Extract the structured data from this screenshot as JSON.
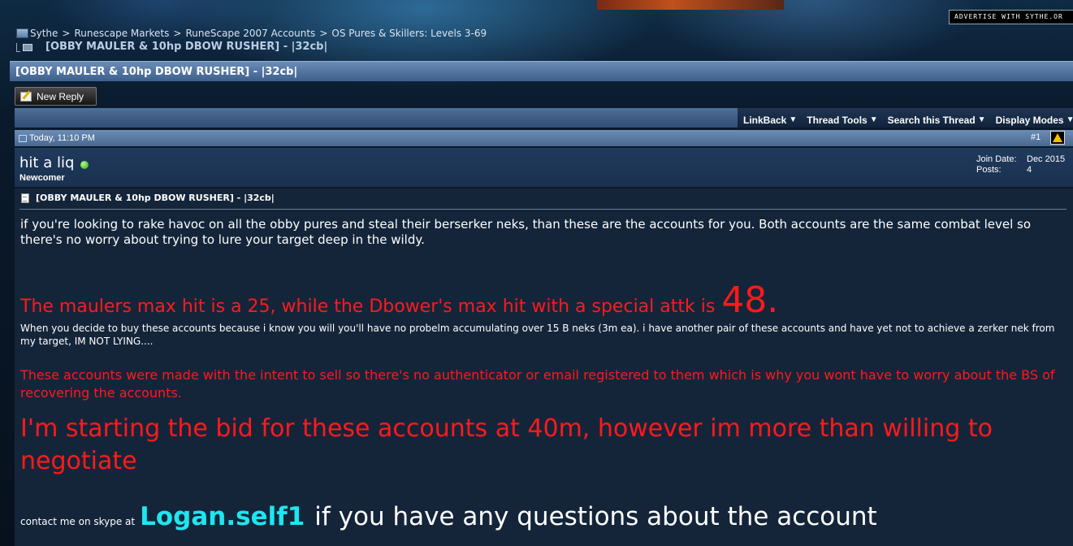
{
  "advertise": "ADVERTISE WITH SYTHE.OR",
  "breadcrumb": {
    "items": [
      "Sythe",
      "Runescape Markets",
      "RuneScape 2007 Accounts",
      "OS Pures & Skillers: Levels 3-69"
    ],
    "separator": ">",
    "current": "[OBBY MAULER & 10hp DBOW RUSHER] - |32cb|"
  },
  "thread": {
    "title": "[OBBY MAULER & 10hp DBOW RUSHER] - |32cb|",
    "new_reply_label": "New Reply"
  },
  "toolbar": {
    "items": [
      "LinkBack",
      "Thread Tools",
      "Search this Thread",
      "Display Modes"
    ]
  },
  "post": {
    "date": "Today, 11:10 PM",
    "number": "#1",
    "username": "hit a liq",
    "usertitle": "Newcomer",
    "join_date_label": "Join Date:",
    "join_date": "Dec 2015",
    "posts_label": "Posts:",
    "posts": "4",
    "title": "[OBBY MAULER & 10hp DBOW RUSHER] - |32cb|",
    "paragraph1": "if you're looking to rake havoc on all the obby pures and steal their berserker neks, than these are the accounts for you. Both accounts are the same combat level so there's no worry about trying to lure your target deep in the wildy.",
    "paragraph2": "The maulers max hit is a 25, while the Dbower's max hit with a special attk is",
    "paragraph2_big": "48.",
    "paragraph3": "When you decide to buy these accounts because i know you will you'll have no probelm accumulating over 15 B neks (3m ea). i have another pair of these accounts and have yet not to achieve a zerker nek from my target, IM NOT LYING....",
    "paragraph4": "These accounts were made with the intent to sell so there's no authenticator or email registered to them which is why you wont have to worry about the BS of recovering the accounts.",
    "paragraph5": "I'm starting the bid for these accounts at 40m, however im more than willing to negotiate",
    "contact_prefix": "contact me on skype at",
    "contact_skype": "Logan.self1",
    "contact_suffix": "if you have any questions about the account"
  },
  "colors": {
    "red_text": "#ff1a1a",
    "skype_cyan": "#1ee6f0",
    "online_green": "#1da11d"
  }
}
